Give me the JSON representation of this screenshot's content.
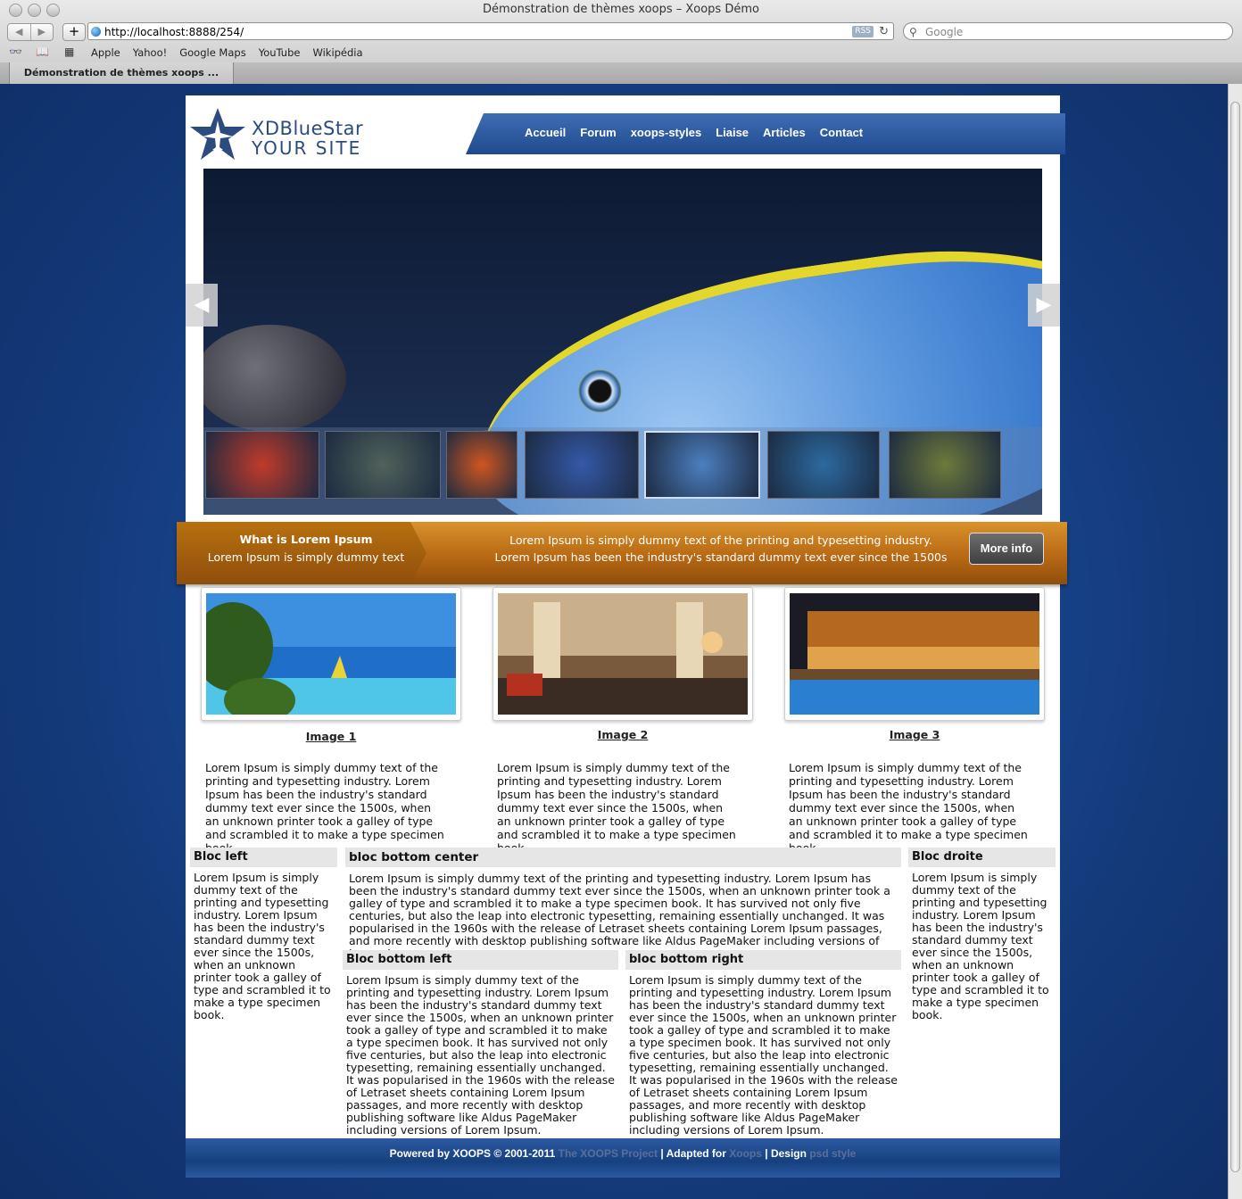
{
  "browser": {
    "window_title": "Démonstration de thèmes xoops – Xoops Démo",
    "back": "◀",
    "forward": "▶",
    "add": "+",
    "url": "http://localhost:8888/254/",
    "rss": "RSS",
    "reload": "↻",
    "search_placeholder": "Google",
    "bookmarks": [
      "Apple",
      "Yahoo!",
      "Google Maps",
      "YouTube",
      "Wikipédia"
    ],
    "tab_title": "Démonstration de thèmes xoops ..."
  },
  "site": {
    "logo_line1": "XDBlueStar",
    "logo_line2": "Your site",
    "nav": [
      "Accueil",
      "Forum",
      "xoops-styles",
      "Liaise",
      "Articles",
      "Contact"
    ]
  },
  "slider": {
    "prev": "◀",
    "next": "▶",
    "thumbs": [
      {
        "name": "anemone-clownfish",
        "color": "#c23a2a"
      },
      {
        "name": "sea-turtle",
        "color": "#50625a"
      },
      {
        "name": "nudibranch",
        "color": "#d0561f"
      },
      {
        "name": "reef-fish",
        "color": "#3559a8"
      },
      {
        "name": "blue-surgeonfish",
        "color": "#4c7fc0"
      },
      {
        "name": "yellow-fish-reef",
        "color": "#2c6aa0"
      },
      {
        "name": "cuttlefish",
        "color": "#6e7a3a"
      }
    ],
    "active_thumb": 4
  },
  "infobar": {
    "left_title": "What is Lorem Ipsum",
    "left_sub": "Lorem Ipsum is simply dummy text",
    "mid_line1": "Lorem Ipsum is simply dummy text of the printing and typesetting industry.",
    "mid_line2": "Lorem Ipsum has been the industry's standard dummy text ever since the 1500s",
    "button": "More info"
  },
  "images": [
    {
      "caption": "Image 1",
      "text": "Lorem Ipsum is simply dummy text of the printing and typesetting industry. Lorem Ipsum has been the industry's standard dummy text ever since the 1500s, when an unknown printer took a galley of type and scrambled it to make a type specimen book."
    },
    {
      "caption": "Image 2",
      "text": "Lorem Ipsum is simply dummy text of the printing and typesetting industry. Lorem Ipsum has been the industry's standard dummy text ever since the 1500s, when an unknown printer took a galley of type and scrambled it to make a type specimen book."
    },
    {
      "caption": "Image 3",
      "text": "Lorem Ipsum is simply dummy text of the printing and typesetting industry. Lorem Ipsum has been the industry's standard dummy text ever since the 1500s, when an unknown printer took a galley of type and scrambled it to make a type specimen book."
    }
  ],
  "blocks": {
    "left": {
      "title": "Bloc left",
      "text": "Lorem Ipsum is simply dummy text of the printing and typesetting industry. Lorem Ipsum has been the industry's standard dummy text ever since the 1500s, when an unknown printer took a galley of type and scrambled it to make a type specimen book."
    },
    "center": {
      "title": "bloc bottom center",
      "text": "Lorem Ipsum is simply dummy text of the printing and typesetting industry. Lorem Ipsum has been the industry's standard dummy text ever since the 1500s, when an unknown printer took a galley of type and scrambled it to make a type specimen book. It has survived not only five centuries, but also the leap into electronic typesetting, remaining essentially unchanged. It was popularised in the 1960s with the release of Letraset sheets containing Lorem Ipsum passages, and more recently with desktop publishing software like Aldus PageMaker including versions of Lorem Ipsum."
    },
    "bottom_left": {
      "title": "Bloc bottom left",
      "text": "Lorem Ipsum is simply dummy text of the printing and typesetting industry. Lorem Ipsum has been the industry's standard dummy text ever since the 1500s, when an unknown printer took a galley of type and scrambled it to make a type specimen book. It has survived not only five centuries, but also the leap into electronic typesetting, remaining essentially unchanged. It was popularised in the 1960s with the release of Letraset sheets containing Lorem Ipsum passages, and more recently with desktop publishing software like Aldus PageMaker including versions of Lorem Ipsum."
    },
    "bottom_right": {
      "title": "bloc bottom right",
      "text": "Lorem Ipsum is simply dummy text of the printing and typesetting industry. Lorem Ipsum has been the industry's standard dummy text ever since the 1500s, when an unknown printer took a galley of type and scrambled it to make a type specimen book. It has survived not only five centuries, but also the leap into electronic typesetting, remaining essentially unchanged. It was popularised in the 1960s with the release of Letraset sheets containing Lorem Ipsum passages, and more recently with desktop publishing software like Aldus PageMaker including versions of Lorem Ipsum."
    },
    "right": {
      "title": "Bloc droite",
      "text": "Lorem Ipsum is simply dummy text of the printing and typesetting industry. Lorem Ipsum has been the industry's standard dummy text ever since the 1500s, when an unknown printer took a galley of type and scrambled it to make a type specimen book."
    }
  },
  "footer": {
    "powered": "Powered by XOOPS © 2001-2011",
    "project_link": "The XOOPS Project",
    "sep1": "| Adapted for",
    "xoops_link": "Xoops",
    "sep2": "| Design",
    "design_link": "psd style"
  }
}
